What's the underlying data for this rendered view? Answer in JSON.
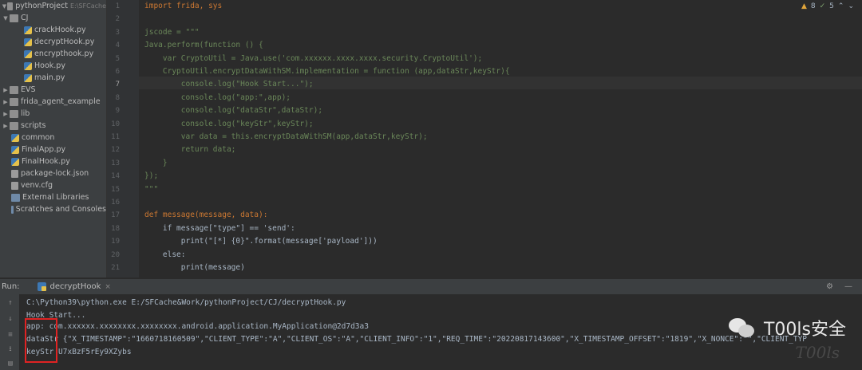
{
  "project": {
    "root_label": "pythonProject",
    "root_path": "E:\\SFCache",
    "items": [
      {
        "label": "CJ",
        "type": "folder",
        "expanded": true
      },
      {
        "label": "crackHook.py",
        "type": "py"
      },
      {
        "label": "decryptHook.py",
        "type": "py"
      },
      {
        "label": "encrypthook.py",
        "type": "py"
      },
      {
        "label": "Hook.py",
        "type": "py"
      },
      {
        "label": "main.py",
        "type": "py"
      },
      {
        "label": "EVS",
        "type": "folder",
        "expanded": false
      },
      {
        "label": "frida_agent_example",
        "type": "folder",
        "expanded": false
      },
      {
        "label": "lib",
        "type": "folder",
        "expanded": false
      },
      {
        "label": "scripts",
        "type": "folder",
        "expanded": false
      },
      {
        "label": "common",
        "type": "py"
      },
      {
        "label": "FinalApp.py",
        "type": "py"
      },
      {
        "label": "FinalHook.py",
        "type": "py"
      },
      {
        "label": "package-lock.json",
        "type": "json"
      },
      {
        "label": "venv.cfg",
        "type": "file"
      },
      {
        "label": "External Libraries",
        "type": "lib"
      },
      {
        "label": "Scratches and Consoles",
        "type": "lib"
      }
    ]
  },
  "editor": {
    "inspection": {
      "warnings": "8",
      "ok": "5"
    },
    "line_numbers": [
      "1",
      "2",
      "3",
      "4",
      "5",
      "6",
      "7",
      "8",
      "9",
      "10",
      "11",
      "12",
      "13",
      "14",
      "15",
      "16",
      "17",
      "18",
      "19",
      "20",
      "21"
    ],
    "lines": [
      "import frida, sys",
      "",
      "jscode = \"\"\"",
      "Java.perform(function () {",
      "    var CryptoUtil = Java.use('com.xxxxxx.xxxx.xxxx.security.CryptoUtil');",
      "    CryptoUtil.encryptDataWithSM.implementation = function (app,dataStr,keyStr){",
      "        console.log(\"Hook Start...\");",
      "        console.log(\"app:\",app);",
      "        console.log(\"dataStr\",dataStr);",
      "        console.log(\"keyStr\",keyStr);",
      "        var data = this.encryptDataWithSM(app,dataStr,keyStr);",
      "        return data;",
      "    }",
      "});",
      "\"\"\"",
      "",
      "def message(message, data):",
      "    if message[\"type\"] == 'send':",
      "        print(\"[*] {0}\".format(message['payload']))",
      "    else:",
      "        print(message)"
    ]
  },
  "run": {
    "label": "Run:",
    "tab": "decryptHook",
    "console": [
      "C:\\Python39\\python.exe E:/SFCache&Work/pythonProject/CJ/decryptHook.py",
      "Hook Start...",
      "app: com.xxxxxx.xxxxxxxx.xxxxxxxx.android.application.MyApplication@2d7d3a3",
      "dataStr {\"X_TIMESTAMP\":\"1660718160509\",\"CLIENT_TYPE\":\"A\",\"CLIENT_OS\":\"A\",\"CLIENT_INFO\":\"1\",\"REQ_TIME\":\"20220817143600\",\"X_TIMESTAMP_OFFSET\":\"1819\",\"X_NONCE\":\"\",\"CLIENT_TYP",
      "keyStr U7xBzF5rEy9XZybs"
    ]
  },
  "watermark": {
    "text": "T00ls安全",
    "sub": "T00ls"
  },
  "colors": {
    "accent_red": "#e02323",
    "keyword": "#cc7832",
    "string": "#6a8759",
    "function": "#ffc66d"
  }
}
